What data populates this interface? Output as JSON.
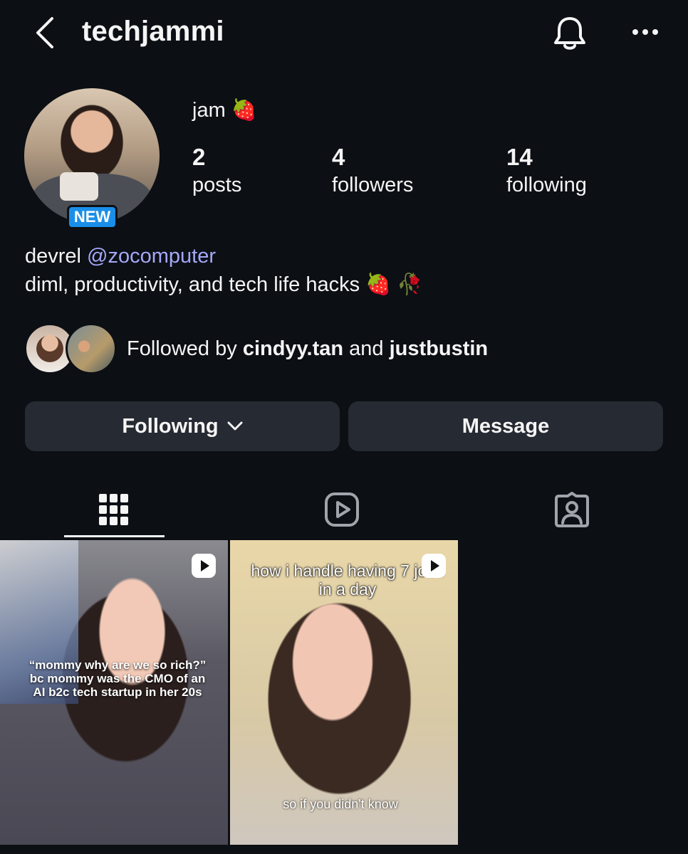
{
  "header": {
    "username": "techjammi",
    "back_icon": "chevron-left-icon",
    "bell_icon": "bell-icon",
    "more_icon": "more-horizontal-icon"
  },
  "profile": {
    "display_name": "jam 🍓",
    "new_badge": "NEW",
    "stats": {
      "posts": {
        "value": "2",
        "label": "posts"
      },
      "followers": {
        "value": "4",
        "label": "followers"
      },
      "following": {
        "value": "14",
        "label": "following"
      }
    },
    "bio": {
      "line1_prefix": "devrel ",
      "mention": "@zocomputer",
      "line2": "diml, productivity, and tech life hacks 🍓 🥀"
    }
  },
  "followed_by": {
    "prefix": "Followed by ",
    "user1": "cindyy.tan",
    "joiner": " and ",
    "user2": "justbustin"
  },
  "actions": {
    "following_label": "Following",
    "message_label": "Message"
  },
  "tabs": [
    {
      "name": "grid",
      "icon": "grid-icon",
      "active": true
    },
    {
      "name": "reels",
      "icon": "reels-icon",
      "active": false
    },
    {
      "name": "tagged",
      "icon": "tagged-icon",
      "active": false
    }
  ],
  "posts": [
    {
      "caption": "“mommy why are we so rich?” bc mommy was the CMO of an AI b2c tech startup in her 20s"
    },
    {
      "caption_top": "how i handle having 7 jobs in a day",
      "caption_bottom": "so if you didn't know"
    }
  ],
  "colors": {
    "background": "#0c0f14",
    "button_bg": "#262a33",
    "mention": "#a5a8f7",
    "new_badge": "#1a8fe9"
  }
}
